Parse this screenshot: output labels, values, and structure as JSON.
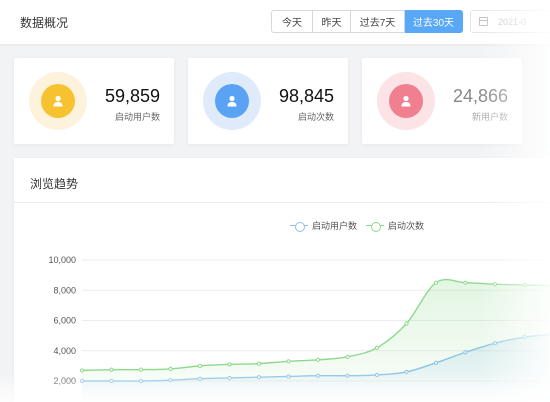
{
  "header": {
    "title": "数据概况",
    "ranges": [
      "今天",
      "昨天",
      "过去7天",
      "过去30天"
    ],
    "active_range": 3,
    "date_picker_text": "2021-0"
  },
  "stats": [
    {
      "value": "59,859",
      "label": "启动用户数",
      "icon": "user-icon",
      "color": "#f7c22f"
    },
    {
      "value": "98,845",
      "label": "启动次数",
      "icon": "user-icon",
      "color": "#5aa2f4"
    },
    {
      "value": "24,866",
      "label": "新用户数",
      "icon": "user-icon",
      "color": "#f07f8f"
    }
  ],
  "trend": {
    "title": "浏览趋势",
    "legend": [
      {
        "label": "启动用户数",
        "color": "#8cc1f0"
      },
      {
        "label": "启动次数",
        "color": "#8fd98f"
      }
    ]
  },
  "chart_data": {
    "type": "area",
    "title": "",
    "xlabel": "",
    "ylabel": "",
    "y_ticks": [
      "10,000",
      "8,000",
      "6,000",
      "4,000",
      "2,000"
    ],
    "ylim": [
      2000,
      10000
    ],
    "x": [
      1,
      2,
      3,
      4,
      5,
      6,
      7,
      8,
      9,
      10,
      11,
      12,
      13,
      14,
      15,
      16,
      17
    ],
    "series": [
      {
        "name": "启动用户数",
        "color": "#8cc1f0",
        "values": [
          2000,
          2000,
          2000,
          2050,
          2150,
          2200,
          2250,
          2300,
          2350,
          2350,
          2400,
          2600,
          3200,
          3900,
          4500,
          4900,
          5100
        ]
      },
      {
        "name": "启动次数",
        "color": "#8fd98f",
        "values": [
          2700,
          2750,
          2750,
          2800,
          3000,
          3100,
          3150,
          3300,
          3400,
          3600,
          4200,
          5800,
          8500,
          8500,
          8400,
          8350,
          8300
        ]
      }
    ],
    "grid": true,
    "legend_position": "top-center"
  }
}
